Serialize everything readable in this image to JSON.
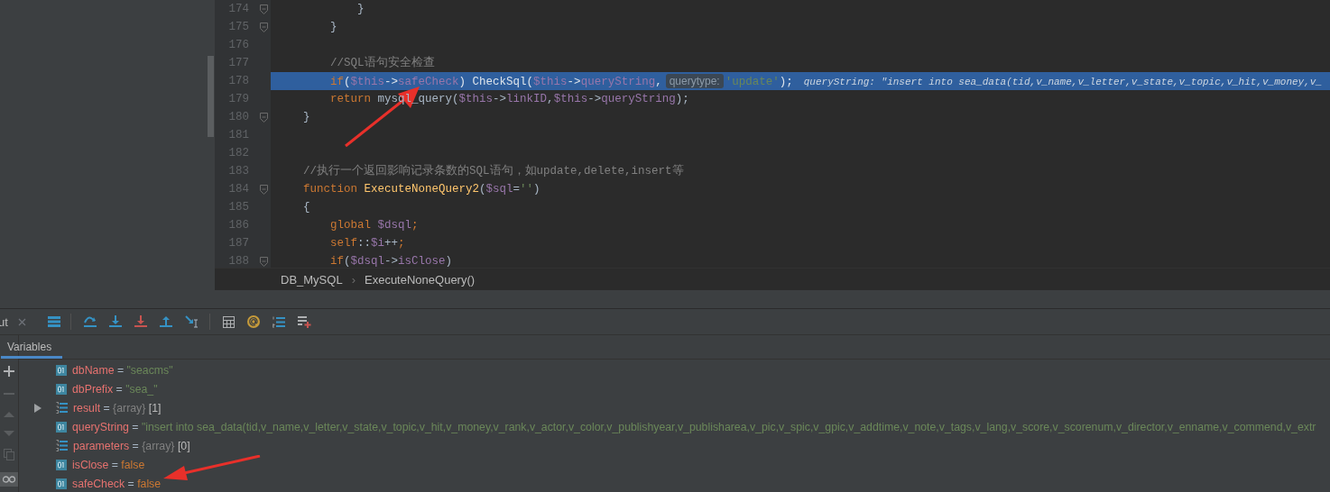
{
  "editor": {
    "lines": [
      {
        "number": "174",
        "fold": true,
        "selected": false,
        "tokens": [
          {
            "kind": "plain",
            "text": "            }"
          }
        ]
      },
      {
        "number": "175",
        "fold": true,
        "selected": false,
        "tokens": [
          {
            "kind": "plain",
            "text": "        }"
          }
        ]
      },
      {
        "number": "176",
        "fold": false,
        "selected": false
      },
      {
        "number": "177",
        "fold": false,
        "selected": false,
        "tokens": [
          {
            "kind": "comment",
            "text": "        //SQL语句安全检查"
          }
        ]
      },
      {
        "number": "178",
        "fold": false,
        "selected": true,
        "tokens": [
          {
            "kind": "keyword",
            "text": "        if"
          },
          {
            "kind": "plain",
            "text": "("
          },
          {
            "kind": "var",
            "text": "$this"
          },
          {
            "kind": "plain",
            "text": "->"
          },
          {
            "kind": "var",
            "text": "safeCheck"
          },
          {
            "kind": "plain",
            "text": ") CheckSql("
          },
          {
            "kind": "var",
            "text": "$this"
          },
          {
            "kind": "plain",
            "text": "->"
          },
          {
            "kind": "var",
            "text": "queryString"
          },
          {
            "kind": "plain",
            "text": ","
          },
          {
            "kind": "hint",
            "text": "querytype:"
          },
          {
            "kind": "string",
            "text": "'update'"
          },
          {
            "kind": "plain",
            "text": ");"
          },
          {
            "kind": "debug",
            "text": "queryString: \"insert into sea_data(tid,v_name,v_letter,v_state,v_topic,v_hit,v_money,v_"
          }
        ]
      },
      {
        "number": "179",
        "fold": false,
        "selected": false,
        "tokens": [
          {
            "kind": "keyword",
            "text": "        return"
          },
          {
            "kind": "plain",
            "text": " mysql_query("
          },
          {
            "kind": "var",
            "text": "$this"
          },
          {
            "kind": "plain",
            "text": "->"
          },
          {
            "kind": "var",
            "text": "linkID"
          },
          {
            "kind": "plain",
            "text": ","
          },
          {
            "kind": "var",
            "text": "$this"
          },
          {
            "kind": "plain",
            "text": "->"
          },
          {
            "kind": "var",
            "text": "queryString"
          },
          {
            "kind": "plain",
            "text": ");"
          }
        ]
      },
      {
        "number": "180",
        "fold": true,
        "selected": false,
        "tokens": [
          {
            "kind": "plain",
            "text": "    }"
          }
        ]
      },
      {
        "number": "181",
        "fold": false,
        "selected": false
      },
      {
        "number": "182",
        "fold": false,
        "selected": false
      },
      {
        "number": "183",
        "fold": false,
        "selected": false,
        "tokens": [
          {
            "kind": "comment",
            "text": "    //执行一个返回影响记录条数的SQL语句，如update,delete,insert等"
          }
        ]
      },
      {
        "number": "184",
        "fold": true,
        "selected": false,
        "tokens": [
          {
            "kind": "keyword",
            "text": "    function"
          },
          {
            "kind": "func",
            "text": " ExecuteNoneQuery2"
          },
          {
            "kind": "plain",
            "text": "("
          },
          {
            "kind": "var",
            "text": "$sql"
          },
          {
            "kind": "plain",
            "text": "="
          },
          {
            "kind": "string",
            "text": "''"
          },
          {
            "kind": "plain",
            "text": ")"
          }
        ]
      },
      {
        "number": "185",
        "fold": false,
        "selected": false,
        "tokens": [
          {
            "kind": "plain",
            "text": "    {"
          }
        ]
      },
      {
        "number": "186",
        "fold": false,
        "selected": false,
        "tokens": [
          {
            "kind": "keyword",
            "text": "        global"
          },
          {
            "kind": "var",
            "text": " $dsql"
          },
          {
            "kind": "keyword",
            "text": ";"
          }
        ]
      },
      {
        "number": "187",
        "fold": false,
        "selected": false,
        "tokens": [
          {
            "kind": "keyword",
            "text": "        self"
          },
          {
            "kind": "plain",
            "text": "::"
          },
          {
            "kind": "var",
            "text": "$i"
          },
          {
            "kind": "plain",
            "text": "++"
          },
          {
            "kind": "keyword",
            "text": ";"
          }
        ]
      },
      {
        "number": "188",
        "fold": true,
        "selected": false,
        "tokens": [
          {
            "kind": "keyword",
            "text": "        if"
          },
          {
            "kind": "plain",
            "text": "("
          },
          {
            "kind": "var",
            "text": "$dsql"
          },
          {
            "kind": "plain",
            "text": "->"
          },
          {
            "kind": "var",
            "text": "isClose"
          },
          {
            "kind": "plain",
            "text": ")"
          }
        ]
      }
    ]
  },
  "breadcrumb": [
    {
      "kind": "item",
      "text": "DB_MySQL"
    },
    {
      "kind": "separator",
      "text": "›"
    },
    {
      "kind": "item",
      "text": "ExecuteNoneQuery()"
    }
  ],
  "debug_tab": {
    "label": "ut"
  },
  "panel_tabs": [
    {
      "label": "Variables",
      "selected": true
    }
  ],
  "variables": [
    {
      "kind": "string",
      "expandable": false,
      "name": "dbName",
      "operator": "=",
      "value": "\"seacms\""
    },
    {
      "kind": "string",
      "expandable": false,
      "name": "dbPrefix",
      "operator": "=",
      "value": "\"sea_\""
    },
    {
      "kind": "array",
      "expandable": true,
      "name": "result",
      "operator": "=",
      "value": "{array}",
      "count": "[1]"
    },
    {
      "kind": "string",
      "expandable": false,
      "name": "queryString",
      "operator": "=",
      "value": "\"insert into sea_data(tid,v_name,v_letter,v_state,v_topic,v_hit,v_money,v_rank,v_actor,v_color,v_publishyear,v_publisharea,v_pic,v_spic,v_gpic,v_addtime,v_note,v_tags,v_lang,v_score,v_scorenum,v_director,v_enname,v_commend,v_extr"
    },
    {
      "kind": "array",
      "expandable": false,
      "name": "parameters",
      "operator": "=",
      "value": "{array}",
      "count": "[0]"
    },
    {
      "kind": "bool",
      "expandable": false,
      "name": "isClose",
      "operator": "=",
      "value": "false"
    },
    {
      "kind": "bool",
      "expandable": false,
      "name": "safeCheck",
      "operator": "=",
      "value": "false"
    }
  ]
}
